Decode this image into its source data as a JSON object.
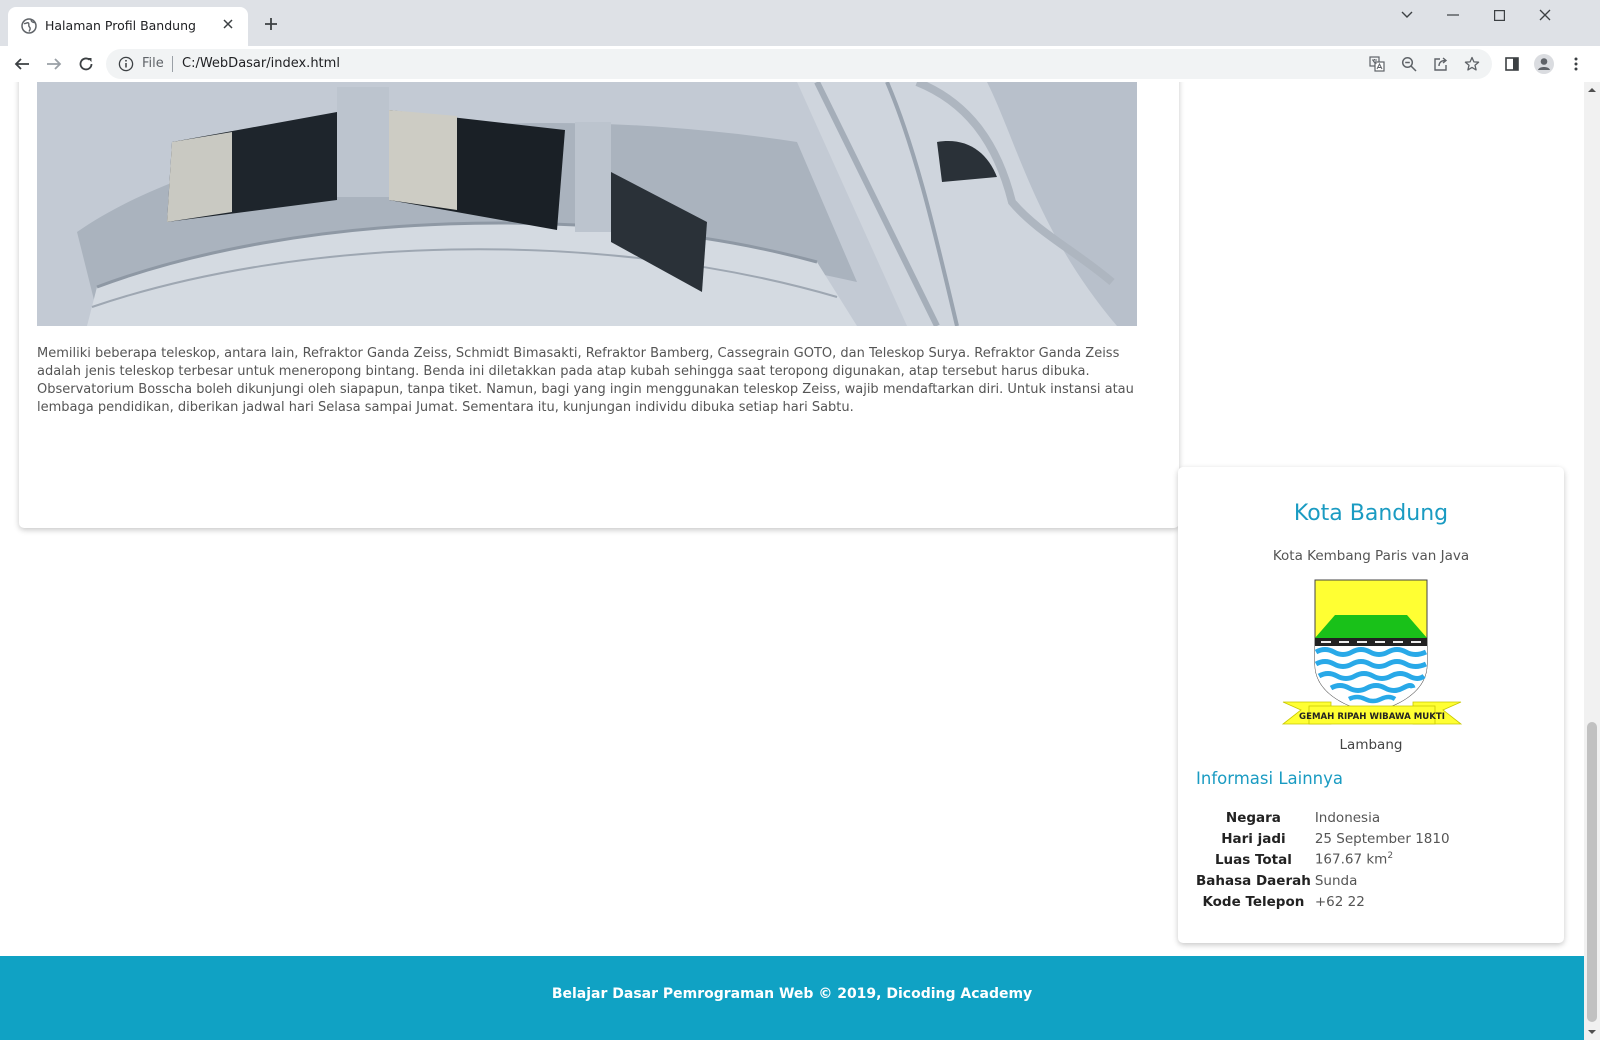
{
  "browser": {
    "tab_title": "Halaman Profil Bandung",
    "file_label": "File",
    "url": "C:/WebDasar/index.html",
    "icons": [
      "globe-icon",
      "close-icon",
      "plus-icon",
      "back-icon",
      "forward-icon",
      "reload-icon",
      "info-icon",
      "translate-icon",
      "zoom-out-icon",
      "share-icon",
      "star-icon",
      "side-panel-icon",
      "profile-icon",
      "menu-icon"
    ]
  },
  "article": {
    "paragraph": "Memiliki beberapa teleskop, antara lain, Refraktor Ganda Zeiss, Schmidt Bimasakti, Refraktor Bamberg, Cassegrain GOTO, dan Teleskop Surya. Refraktor Ganda Zeiss adalah jenis teleskop terbesar untuk meneropong bintang. Benda ini diletakkan pada atap kubah sehingga saat teropong digunakan, atap tersebut harus dibuka. Observatorium Bosscha boleh dikunjungi oleh siapapun, tanpa tiket. Namun, bagi yang ingin menggunakan teleskop Zeiss, wajib mendaftarkan diri. Untuk instansi atau lembaga pendidikan, diberikan jadwal hari Selasa sampai Jumat. Sementara itu, kunjungan individu dibuka setiap hari Sabtu."
  },
  "profile": {
    "title": "Kota Bandung",
    "tagline": "Kota Kembang Paris van Java",
    "emblem_motto": "GEMAH RIPAH WIBAWA MUKTI",
    "emblem_caption": "Lambang",
    "info_heading": "Informasi Lainnya",
    "rows": [
      {
        "label": "Negara",
        "value": "Indonesia"
      },
      {
        "label": "Hari jadi",
        "value": "25 September 1810"
      },
      {
        "label": "Luas Total",
        "value": "167.67 km",
        "sup": "2"
      },
      {
        "label": "Bahasa Daerah",
        "value": "Sunda"
      },
      {
        "label": "Kode Telepon",
        "value": "+62 22"
      }
    ]
  },
  "footer": {
    "text": "Belajar Dasar Pemrograman Web © 2019, Dicoding Academy"
  },
  "colors": {
    "accent": "#1a9bc2",
    "footer_bg": "#10a2c4",
    "emblem_yellow": "#ffff33",
    "emblem_green": "#19c119",
    "emblem_blue": "#29a9e8"
  }
}
